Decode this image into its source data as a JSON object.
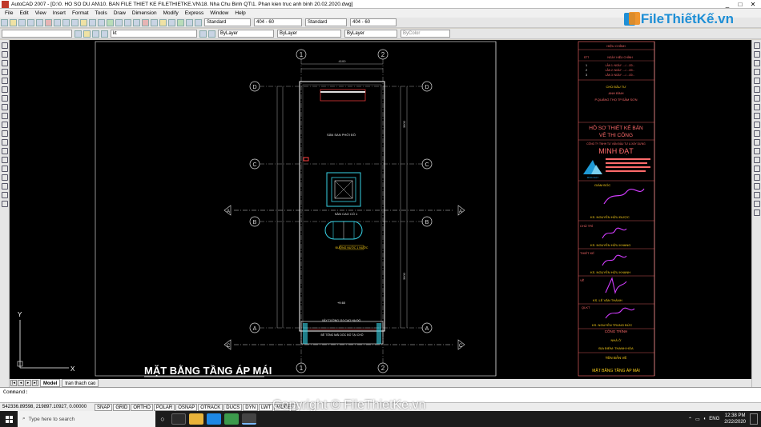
{
  "window": {
    "title": "AutoCAD 2007 - [D:\\0. HO SO DU AN\\10. BAN FILE THIET KE FILETHIETKE.VN\\18. Nha Chu Binh QT\\1. Phan kien truc anh binh 20.02.2020.dwg]",
    "controls": [
      "_",
      "□",
      "✕"
    ]
  },
  "menu": [
    "File",
    "Edit",
    "View",
    "Insert",
    "Format",
    "Tools",
    "Draw",
    "Dimension",
    "Modify",
    "Express",
    "Window",
    "Help"
  ],
  "toolbar": {
    "text_style": "Standard",
    "dim_style": "404 - 60",
    "table_style": "Standard",
    "multileader_style": "404 - 60",
    "layer": "kt",
    "color": "ByLayer",
    "linetype": "ByLayer",
    "lineweight": "ByLayer",
    "plotstyle": "ByColor"
  },
  "logo": {
    "text": "FileThiếtKế.vn"
  },
  "drawing": {
    "grid_top": [
      "1",
      "2"
    ],
    "grid_bottom": [
      "1",
      "2"
    ],
    "grid_rows": [
      "D",
      "C",
      "B",
      "A",
      "A",
      "C"
    ],
    "main_title": "MẶT BẰNG TẦNG ÁP MÁI",
    "dim_top": "4100",
    "dim_right_1": "3800",
    "dim_right_2": "3800",
    "room_label_1": "SÀN SAN PHỚI ĐỒ",
    "room_label_2": "SÀN CAO CỐ 1",
    "note_1": "XÂY TƯỜNG 110 CAO HẠ ĐỔ",
    "note_2": "BÊ TÔNG MÁI DỐC ĐỔ TẠI CHỖ",
    "level_mark": "+9.60",
    "yellow_tag": "ĐƯỜNG NƯỚC 1 NƯỚC"
  },
  "title_block": {
    "revision_header": "HIỆU CHỈNH",
    "rev_col1": "STT",
    "rev_col2": "NGÀY HIỆU CHỈNH",
    "revisions": [
      "LẦN 1: NGÀY ..../..../20...",
      "LẦN 2: NGÀY ..../..../20...",
      "LẦN 3: NGÀY ..../..../20..."
    ],
    "rev_nums": [
      "1",
      "2",
      "3"
    ],
    "owner_label": "CHỦ ĐẦU TƯ",
    "owner_name": "ANH BÌNH",
    "owner_address": "P.QUẢNG THỌ TP.SẦM SƠN",
    "project_line1": "HỒ SƠ THIẾT KẾ BẢN",
    "project_line2": "VẼ THI CÔNG",
    "company_line": "CÔNG TY TNHH TƯ VẤN ĐẦU TƯ & XÂY DỰNG",
    "company_name": "MINH ĐẠT",
    "logo_short": "MINH ĐẠT",
    "director_label": "GIÁM ĐỐC",
    "director_name": "KS. NGUYỄN HỮU ĐƯỢC",
    "chief_label": "CHỦ TRÌ",
    "chief_name": "KS. NGUYỄN HỮU KHANG",
    "designer_label": "THIẾT KẾ",
    "designer_name": "KS. NGUYỄN HỮU KHANH",
    "drafter_label": "VẼ",
    "drafter_name": "KS. LÊ VĂN THÀNH",
    "qa_label": "QLKT",
    "qa_name": "KS. NGUYỄN TRUNG ĐỨC",
    "work_label": "CÔNG TRÌNH",
    "work_name": "NHÀ Ở",
    "location_label": "ĐỊA ĐIỂM: THANH HÓA",
    "sheet_label": "TÊN BẢN VẼ",
    "sheet_name": "MẶT BẰNG TẦNG ÁP MÁI"
  },
  "ucs": {
    "x": "X",
    "y": "Y"
  },
  "tabs": [
    "Model",
    "tran thach cao"
  ],
  "command": {
    "prompt": "Command:"
  },
  "status": {
    "coords": "542336.89598, 219897.10927, 0.00000",
    "buttons": [
      "SNAP",
      "GRID",
      "ORTHO",
      "POLAR",
      "OSNAP",
      "OTRACK",
      "DUCS",
      "DYN",
      "LWT",
      "MODEL"
    ]
  },
  "watermark": "Copyright © FileThietKe.vn",
  "taskbar": {
    "search_placeholder": "Type here to search",
    "lang": "ENG",
    "time": "12:38 PM",
    "date": "2/22/2020"
  },
  "colors": {
    "canvas": "#000000",
    "accent_red": "#ff3b3b",
    "accent_yellow": "#ffd21a",
    "accent_magenta": "#d23cff",
    "accent_cyan": "#37d3e6",
    "logo_blue": "#1e8fd6"
  }
}
